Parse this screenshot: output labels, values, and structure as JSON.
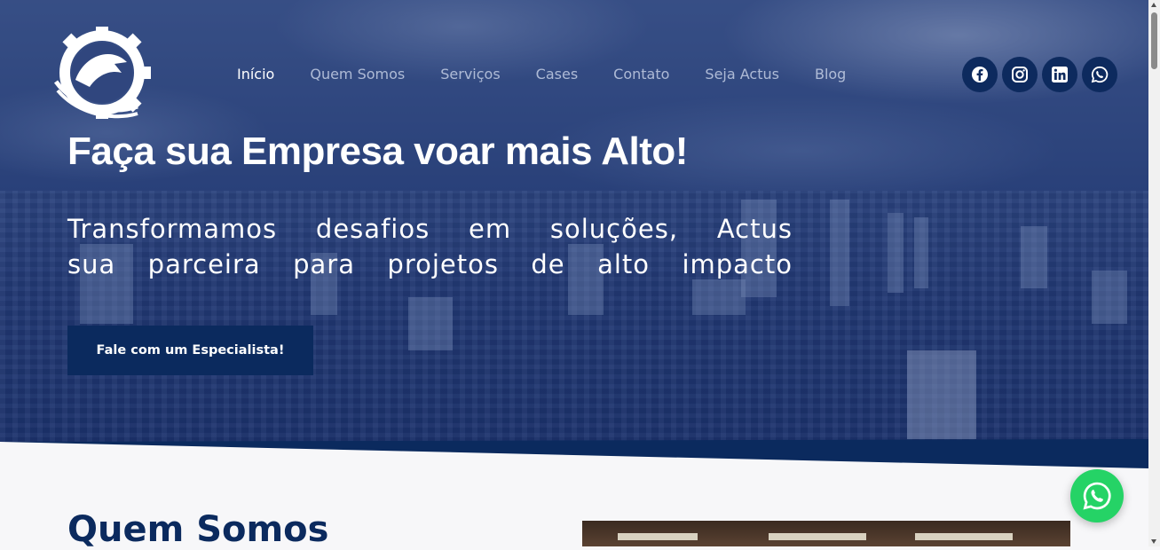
{
  "nav": {
    "items": [
      {
        "label": "Início",
        "active": true
      },
      {
        "label": "Quem Somos",
        "active": false
      },
      {
        "label": "Serviços",
        "active": false
      },
      {
        "label": "Cases",
        "active": false
      },
      {
        "label": "Contato",
        "active": false
      },
      {
        "label": "Seja Actus",
        "active": false
      },
      {
        "label": "Blog",
        "active": false
      }
    ]
  },
  "social": [
    "facebook-icon",
    "instagram-icon",
    "linkedin-icon",
    "whatsapp-icon"
  ],
  "hero": {
    "title": "Faça sua Empresa voar mais Alto!",
    "subtitle_line1": "Transformamos desafios em soluções, Actus",
    "subtitle_line2": "sua parceira para projetos de alto impacto",
    "cta_label": "Fale com um Especialista!"
  },
  "about": {
    "title": "Quem Somos"
  },
  "colors": {
    "brand_navy": "#0b2a5e",
    "whatsapp_green": "#25d366"
  }
}
